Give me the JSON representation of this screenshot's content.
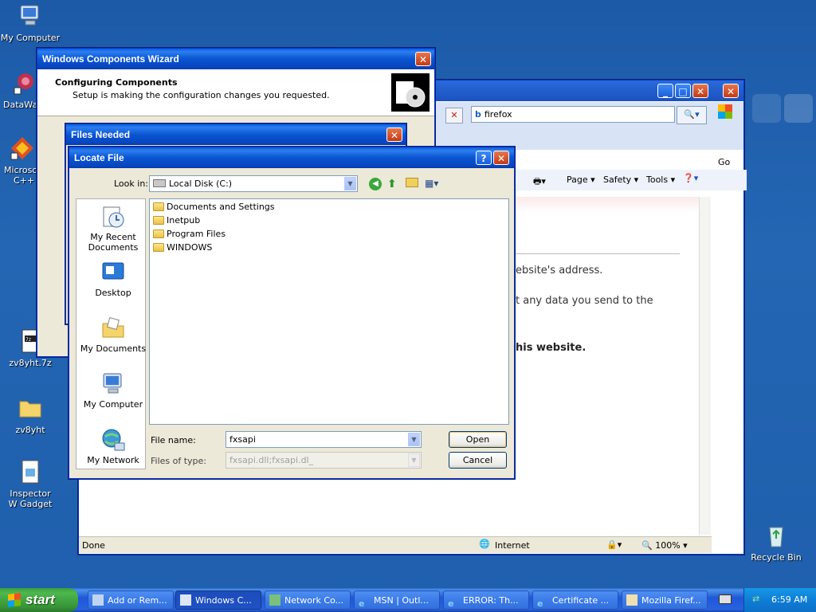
{
  "desktop": {
    "icons": [
      {
        "label": "My Computer"
      },
      {
        "label": "DataWa"
      },
      {
        "label": "Microsoft C++"
      },
      {
        "label": "zv8yht.7z"
      },
      {
        "label": "zv8yht"
      },
      {
        "label": "Inspector W Gadget"
      },
      {
        "label": "Recycle Bin"
      }
    ]
  },
  "ie_window": {
    "address_value": "firefox",
    "go_label": "Go",
    "toolbar": {
      "page": "Page",
      "safety": "Safety",
      "tools": "Tools"
    },
    "content": {
      "line1": "ebsite's address.",
      "line2": "t any data you send to the",
      "line3": "his website."
    },
    "status": {
      "left": "Done",
      "zone": "Internet",
      "zoom": "100%"
    }
  },
  "wizard": {
    "title": "Windows Components Wizard",
    "heading": "Configuring Components",
    "subheading": "Setup is making the configuration changes you requested."
  },
  "files_needed": {
    "title": "Files Needed"
  },
  "locate_file": {
    "title": "Locate File",
    "look_in_label": "Look in:",
    "look_in_value": "Local Disk (C:)",
    "places": [
      {
        "label": "My Recent Documents"
      },
      {
        "label": "Desktop"
      },
      {
        "label": "My Documents"
      },
      {
        "label": "My Computer"
      },
      {
        "label": "My Network"
      }
    ],
    "folders": [
      "Documents and Settings",
      "Inetpub",
      "Program Files",
      "WINDOWS"
    ],
    "file_name_label": "File name:",
    "file_name_value": "fxsapi",
    "files_of_type_label": "Files of type:",
    "files_of_type_value": "fxsapi.dll;fxsapi.dl_",
    "open_label": "Open",
    "cancel_label": "Cancel"
  },
  "taskbar": {
    "start_label": "start",
    "tasks": [
      {
        "label": "Add or Rem..."
      },
      {
        "label": "Windows C..."
      },
      {
        "label": "Network Co..."
      },
      {
        "label": "MSN | Outl..."
      },
      {
        "label": "ERROR: Th..."
      },
      {
        "label": "Certificate ..."
      },
      {
        "label": "Mozilla Firef..."
      }
    ],
    "clock": "6:59 AM"
  }
}
